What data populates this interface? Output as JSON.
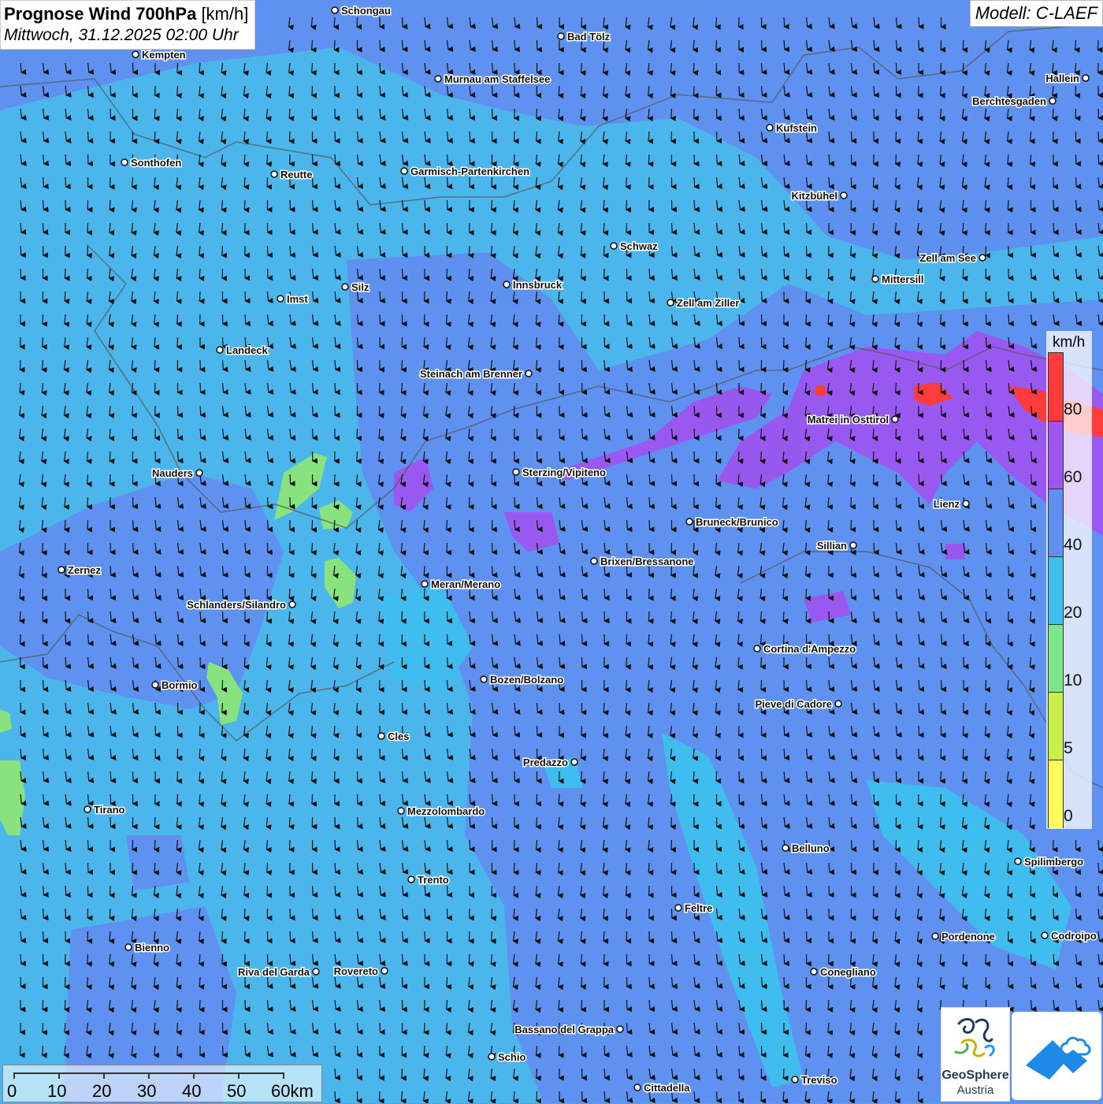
{
  "header": {
    "title_main": "Prognose Wind 700hPa",
    "title_unit": "[km/h]",
    "subtitle": "Mittwoch, 31.12.2025 02:00 Uhr",
    "model": "Modell: C-LAEF"
  },
  "legend": {
    "unit": "km/h",
    "labels": [
      "80",
      "60",
      "40",
      "20",
      "10",
      "5",
      "0"
    ],
    "colors": {
      "80+": "#ff2f2f",
      "60-80": "#9a4cf0",
      "40-60": "#5b8ff0",
      "20-40": "#2fbcf0",
      "10-20": "#7ae88a",
      "5-10": "#c8f04a",
      "0-5": "#fffb5a"
    }
  },
  "scale": {
    "labels": [
      "0",
      "10",
      "20",
      "30",
      "40",
      "50",
      "60km"
    ]
  },
  "cities": [
    {
      "name": "Schongau"
    },
    {
      "name": "Bad Tölz"
    },
    {
      "name": "Kempten"
    },
    {
      "name": "Murnau am Staffelsee"
    },
    {
      "name": "Hallein"
    },
    {
      "name": "Berchtesgaden"
    },
    {
      "name": "Kufstein"
    },
    {
      "name": "Sonthofen"
    },
    {
      "name": "Reutte"
    },
    {
      "name": "Garmisch-Partenkirchen"
    },
    {
      "name": "Kitzbühel"
    },
    {
      "name": "Schwaz"
    },
    {
      "name": "Zell am See"
    },
    {
      "name": "Mittersill"
    },
    {
      "name": "Innsbruck"
    },
    {
      "name": "Silz"
    },
    {
      "name": "Imst"
    },
    {
      "name": "Zell am Ziller"
    },
    {
      "name": "Landeck"
    },
    {
      "name": "Steinach am Brenner"
    },
    {
      "name": "Matrei in Osttirol"
    },
    {
      "name": "Nauders"
    },
    {
      "name": "Sterzing/Vipiteno"
    },
    {
      "name": "Lienz"
    },
    {
      "name": "Bruneck/Brunico"
    },
    {
      "name": "Sillian"
    },
    {
      "name": "Brixen/Bressanone"
    },
    {
      "name": "Zernez"
    },
    {
      "name": "Meran/Merano"
    },
    {
      "name": "Schlanders/Silandro"
    },
    {
      "name": "Cortina d'Ampezzo"
    },
    {
      "name": "Bozen/Bolzano"
    },
    {
      "name": "Bormio"
    },
    {
      "name": "Pieve di Cadore"
    },
    {
      "name": "Cles"
    },
    {
      "name": "Predazzo"
    },
    {
      "name": "Tirano"
    },
    {
      "name": "Mezzolombardo"
    },
    {
      "name": "Belluno"
    },
    {
      "name": "Spilimbergo"
    },
    {
      "name": "Trento"
    },
    {
      "name": "Feltre"
    },
    {
      "name": "Pordenone"
    },
    {
      "name": "Codroipo"
    },
    {
      "name": "Bienno"
    },
    {
      "name": "Riva del Garda"
    },
    {
      "name": "Rovereto"
    },
    {
      "name": "Conegliano"
    },
    {
      "name": "Bassano del Grappa"
    },
    {
      "name": "Schio"
    },
    {
      "name": "Treviso"
    },
    {
      "name": "Cittadella"
    }
  ],
  "logos": {
    "geosphere_line1": "GeoSphere",
    "geosphere_line2": "Austria"
  },
  "wind_direction": "north-to-south"
}
